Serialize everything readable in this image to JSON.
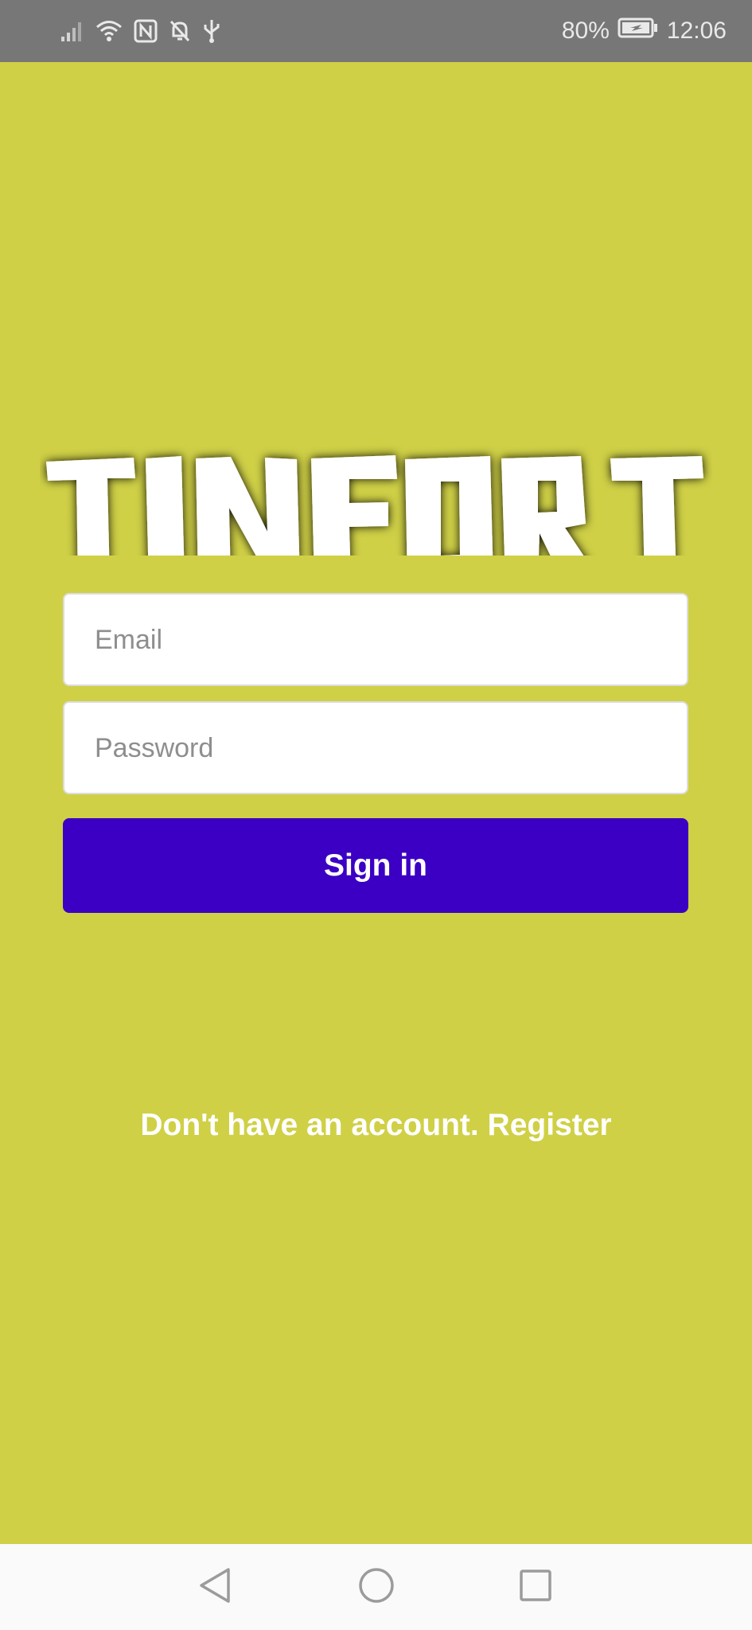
{
  "status_bar": {
    "battery_percent": "80%",
    "time": "12:06",
    "icons": [
      "signal-icon",
      "wifi-icon",
      "nfc-icon",
      "mute-bell-icon",
      "usb-icon",
      "battery-icon"
    ]
  },
  "logo": {
    "text": "TINFORT"
  },
  "login_form": {
    "email_placeholder": "Email",
    "email_value": "",
    "password_placeholder": "Password",
    "password_value": "",
    "signin_label": "Sign in"
  },
  "register": {
    "label": "Don't have an account. Register"
  },
  "nav_bar": {
    "icons": [
      "back-icon",
      "home-icon",
      "recents-icon"
    ]
  },
  "colors": {
    "background": "#cfd046",
    "status_bar": "#777777",
    "button": "#3b00c4",
    "button_text": "#ffffff",
    "nav_bar": "#fafafa"
  }
}
